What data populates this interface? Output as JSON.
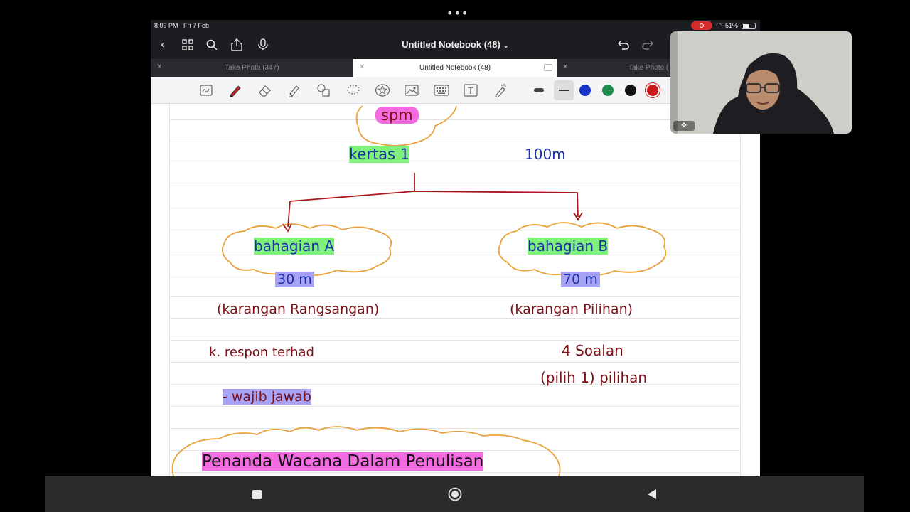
{
  "status_bar": {
    "time": "8:09 PM",
    "date": "Fri 7 Feb",
    "battery": "51%"
  },
  "header": {
    "title": "Untitled Notebook (48)",
    "title_chevron": "⌄"
  },
  "tabs": [
    {
      "label": "Take Photo (347)",
      "active": false
    },
    {
      "label": "Untitled Notebook (48)",
      "active": true
    },
    {
      "label": "Take Photo (",
      "active": false
    }
  ],
  "colors": {
    "blue": "#1532c4",
    "green": "#1e8a4c",
    "black": "#111111",
    "red": "#c81c1c",
    "ink_dark_red": "#7a0f16",
    "ink_blue": "#1a2fa8",
    "cloud_orange": "#e9a23b"
  },
  "icons": {
    "back": "back-chevron-icon",
    "grid": "grid-icon",
    "search": "search-icon",
    "share": "share-icon",
    "mic": "mic-icon",
    "undo": "undo-icon",
    "redo": "redo-icon"
  },
  "notes": {
    "spm": "spm",
    "kertas": "kertas 1",
    "marks_total": "100m",
    "bahagian_a": "bahagian A",
    "bahagian_b": "bahagian B",
    "marks_a": "30 m",
    "marks_b": "70 m",
    "karangan_a": "(karangan Rangsangan)",
    "karangan_b": "(karangan Pilihan)",
    "respon": "k. respon terhad",
    "wajib": "- wajib jawab",
    "soalan": "4 Soalan",
    "pilih": "(pilih 1) pilihan",
    "penanda": "Penanda Wacana Dalam Penulisan"
  }
}
